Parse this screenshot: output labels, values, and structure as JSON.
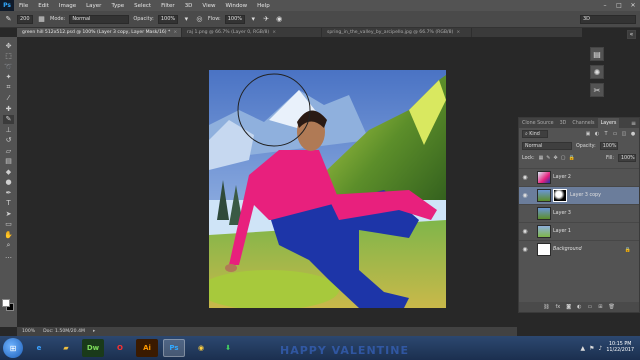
{
  "app": {
    "logo": "Ps"
  },
  "menu": [
    "File",
    "Edit",
    "Image",
    "Layer",
    "Type",
    "Select",
    "Filter",
    "3D",
    "View",
    "Window",
    "Help"
  ],
  "window_controls": [
    "–",
    "□",
    "✕"
  ],
  "options_bar": {
    "brush_size": "200",
    "mode_label": "Mode:",
    "mode_value": "Normal",
    "opacity_label": "Opacity:",
    "opacity_value": "100%",
    "flow_label": "Flow:",
    "flow_value": "100%",
    "workspace": "3D"
  },
  "tabs": [
    {
      "label": "green hill 512x512.psd @ 100% (Layer 3 copy, Layer Mask/16) *",
      "active": true
    },
    {
      "label": "raj 1.png @ 66.7% (Layer 0, RGB/8)",
      "active": false
    },
    {
      "label": "spring_in_the_valley_by_arcipello.jpg @ 66.7% (RGB/8)",
      "active": false
    }
  ],
  "status": {
    "zoom": "100%",
    "doc": "Doc: 1.50M/20.4M"
  },
  "layers_panel": {
    "tabs": [
      "Clone Source",
      "3D",
      "Channels",
      "Layers"
    ],
    "active_tab": "Layers",
    "kind": "Kind",
    "blend_mode": "Normal",
    "opacity_label": "Opacity:",
    "opacity_value": "100%",
    "lock_label": "Lock:",
    "fill_label": "Fill:",
    "fill_value": "100%",
    "layers": [
      {
        "name": "Layer 2",
        "visible": true,
        "selected": false,
        "mask": false
      },
      {
        "name": "Layer 3 copy",
        "visible": true,
        "selected": true,
        "mask": true
      },
      {
        "name": "Layer 3",
        "visible": false,
        "selected": false,
        "mask": false
      },
      {
        "name": "Layer 1",
        "visible": true,
        "selected": false,
        "mask": false
      },
      {
        "name": "Background",
        "visible": true,
        "selected": false,
        "mask": false,
        "locked": true
      }
    ],
    "footer_icons": [
      "link-icon",
      "fx-icon",
      "mask-icon",
      "adjustment-icon",
      "group-icon",
      "new-layer-icon",
      "trash-icon"
    ]
  },
  "taskbar": {
    "apps": [
      "ie-icon",
      "explorer-icon",
      "dreamweaver-icon",
      "opera-icon",
      "illustrator-icon",
      "photoshop-icon",
      "chrome-icon",
      "downloader-icon"
    ],
    "app_labels": {
      "dw": "Dw",
      "ai": "Ai",
      "ps": "Ps"
    },
    "time": "10:15 PM",
    "date": "11/22/2017",
    "wallpaper_text": "HAPPY VALENTINE"
  }
}
